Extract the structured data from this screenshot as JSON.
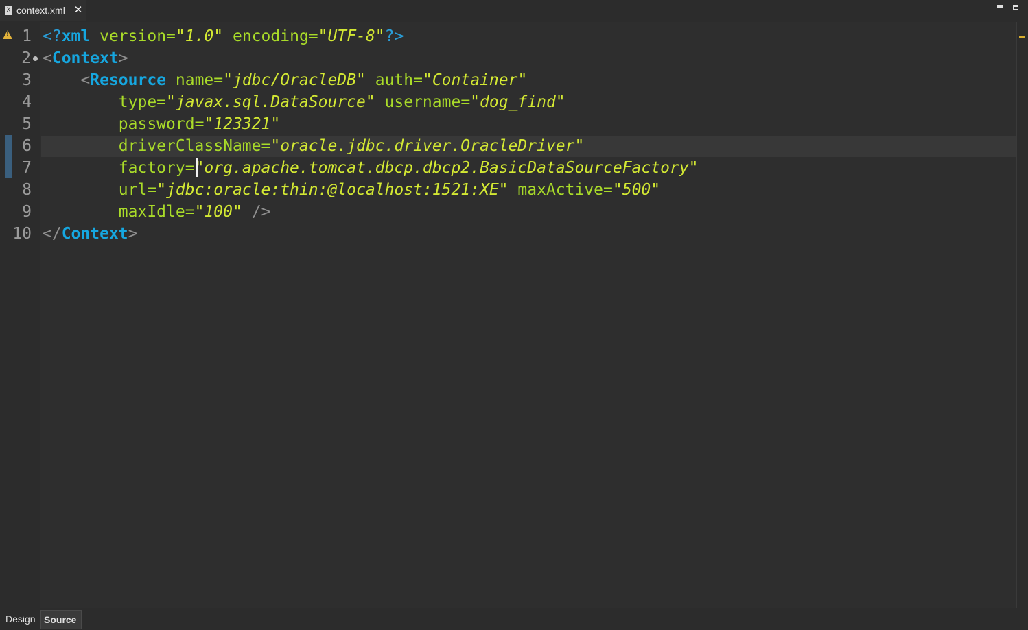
{
  "editor_tab": {
    "file_icon": "X",
    "file_icon_name": "xml-file-icon",
    "label": "context.xml",
    "close_glyph": "✕"
  },
  "window_controls": [
    "minimize",
    "maximize"
  ],
  "line_numbers": [
    "1",
    "2",
    "3",
    "4",
    "5",
    "6",
    "7",
    "8",
    "9",
    "10"
  ],
  "code": {
    "l1": {
      "pi_open": "<?",
      "tag": "xml",
      "a1": "version",
      "eq1": "=",
      "v1": "\"1.0\"",
      "a2": "encoding",
      "eq2": "=",
      "v2": "\"UTF-8\"",
      "pi_close": "?>"
    },
    "l2": {
      "open": "<",
      "tag": "Context",
      "close": ">"
    },
    "l3": {
      "indent": "    ",
      "open": "<",
      "tag": "Resource",
      "a1": "name",
      "eq1": "=",
      "v1": "\"jdbc/OracleDB\"",
      "a2": "auth",
      "eq2": "=",
      "v2": "\"Container\""
    },
    "l4": {
      "indent": "        ",
      "a1": "type",
      "eq1": "=",
      "v1": "\"javax.sql.DataSource\"",
      "a2": "username",
      "eq2": "=",
      "v2": "\"dog_find\""
    },
    "l5": {
      "indent": "        ",
      "a1": "password",
      "eq1": "=",
      "v1": "\"123321\""
    },
    "l6": {
      "indent": "        ",
      "a1": "driverClassName",
      "eq1": "=",
      "v1": "\"oracle.jdbc.driver.OracleDriver\""
    },
    "l7": {
      "indent": "        ",
      "a1": "factory",
      "eq1": "=",
      "v1": "\"org.apache.tomcat.dbcp.dbcp2.BasicDataSourceFactory\""
    },
    "l8": {
      "indent": "        ",
      "a1": "url",
      "eq1": "=",
      "v1": "\"jdbc:oracle:thin:@localhost:1521:XE\"",
      "a2": "maxActive",
      "eq2": "=",
      "v2": "\"500\""
    },
    "l9": {
      "indent": "        ",
      "a1": "maxIdle",
      "eq1": "=",
      "v1": "\"100\"",
      "selfclose": "/>"
    },
    "l10": {
      "open": "</",
      "tag": "Context",
      "close": ">"
    }
  },
  "bottom_tabs": {
    "design": "Design",
    "source": "Source",
    "active": "Source"
  },
  "colors": {
    "background": "#2e2e2e",
    "tag": "#16a7e0",
    "attribute": "#a9db29",
    "value": "#d3e833",
    "punctuation": "#8f8f8f",
    "warning": "#e2b23a"
  }
}
